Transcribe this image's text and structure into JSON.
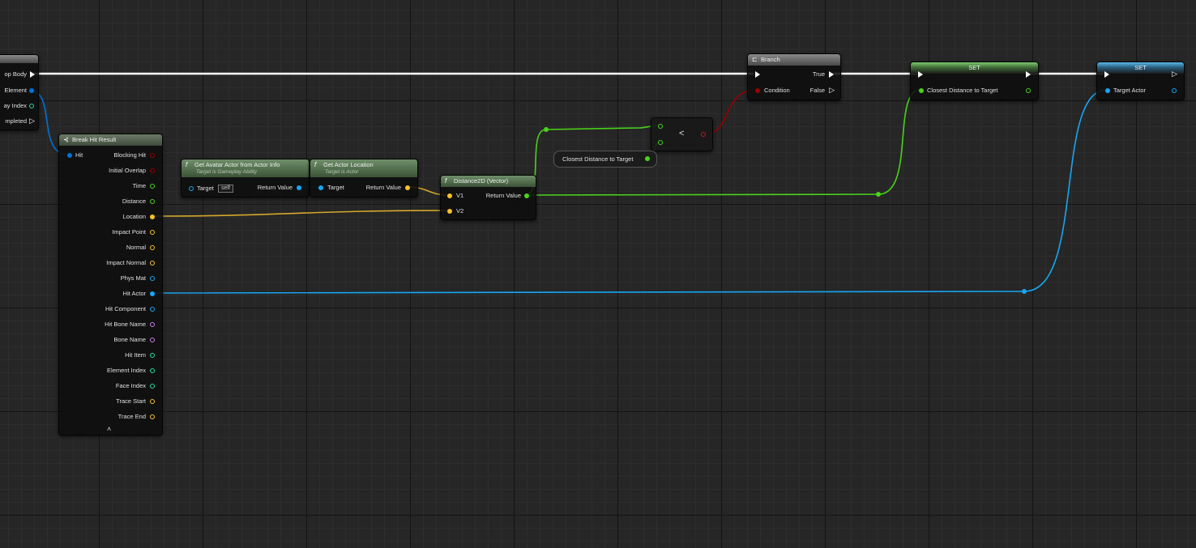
{
  "colors": {
    "exec": "#ffffff",
    "struct": "#0072d8",
    "object": "#17a6f2",
    "float": "#4ad21a",
    "vector": "#f7c22a",
    "bool": "#9a0000",
    "name": "#c57ee6",
    "int": "#1fe0a3",
    "text": "#dcdcdc"
  },
  "loop_node": {
    "pins": [
      "op Body",
      "Element",
      "ay Index",
      "mpleted"
    ]
  },
  "break_hit": {
    "title": "Break Hit Result",
    "input": "Hit",
    "outputs": [
      "Blocking Hit",
      "Initial Overlap",
      "Time",
      "Distance",
      "Location",
      "Impact Point",
      "Normal",
      "Impact Normal",
      "Phys Mat",
      "Hit Actor",
      "Hit Component",
      "Hit Bone Name",
      "Bone Name",
      "Hit Item",
      "Element Index",
      "Face Index",
      "Trace Start",
      "Trace End"
    ],
    "expand_icon": "chevron-up-icon"
  },
  "get_avatar": {
    "title": "Get Avatar Actor from Actor Info",
    "subtitle": "Target is Gameplay Ability",
    "target_label": "Target",
    "target_value": "self",
    "return_label": "Return Value"
  },
  "get_location": {
    "title": "Get Actor Location",
    "subtitle": "Target is Actor",
    "target_label": "Target",
    "return_label": "Return Value"
  },
  "distance": {
    "title": "Distance2D (Vector)",
    "v1": "V1",
    "v2": "V2",
    "return_label": "Return Value"
  },
  "less": {
    "op": "<"
  },
  "closest_var": {
    "label": "Closest Distance to Target"
  },
  "branch": {
    "title": "Branch",
    "condition": "Condition",
    "true_label": "True",
    "false_label": "False"
  },
  "set1": {
    "title": "SET",
    "pin": "Closest Distance to Target"
  },
  "set2": {
    "title": "SET",
    "pin": "Target Actor"
  }
}
